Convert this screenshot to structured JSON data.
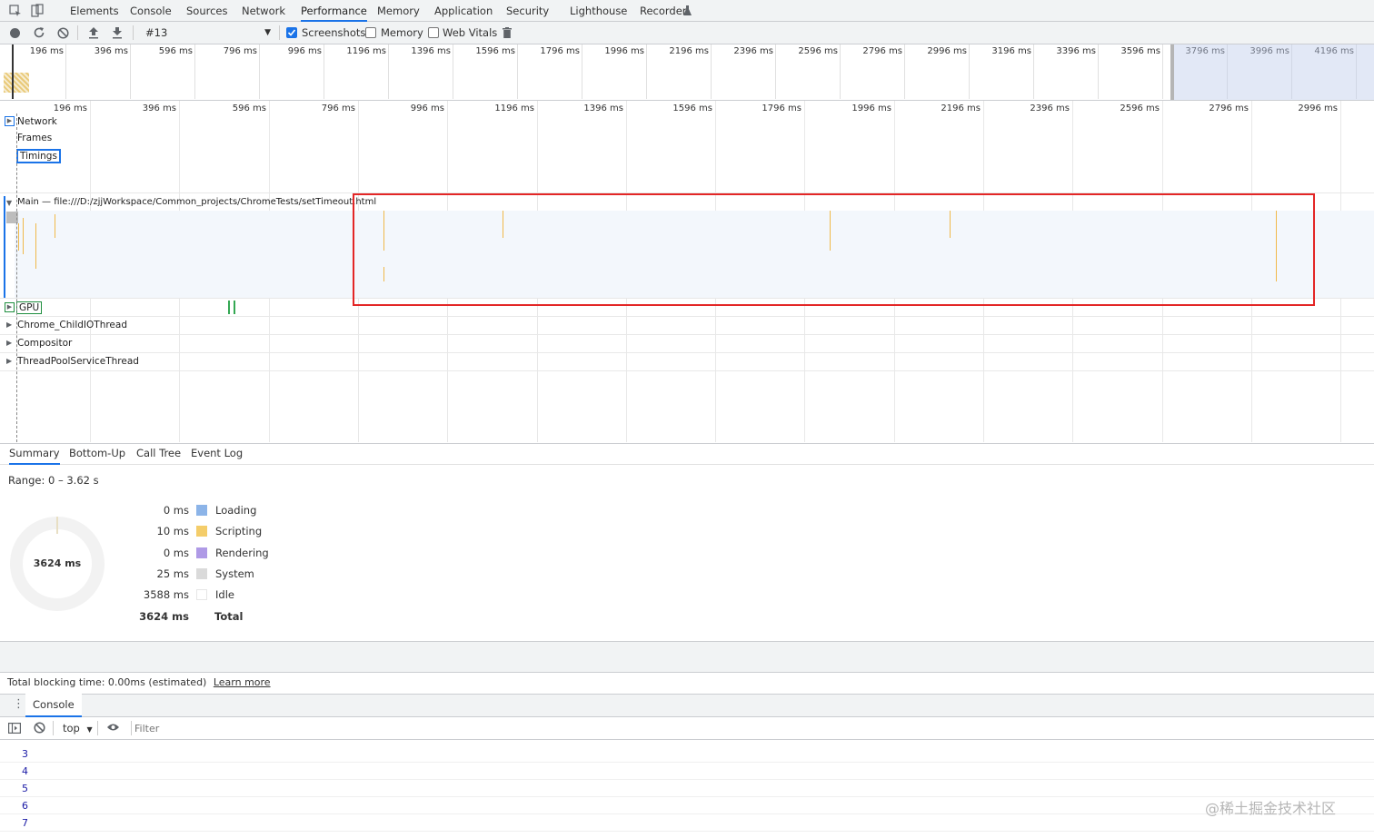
{
  "tabs": [
    "Elements",
    "Console",
    "Sources",
    "Network",
    "Performance",
    "Memory",
    "Application",
    "Security",
    "Lighthouse",
    "Recorder"
  ],
  "active_tab": "Performance",
  "toolbar": {
    "recording_select": "#13",
    "screenshots_label": "Screenshots",
    "screenshots_checked": true,
    "memory_label": "Memory",
    "webvitals_label": "Web Vitals"
  },
  "overview_ticks": [
    "196 ms",
    "396 ms",
    "596 ms",
    "796 ms",
    "996 ms",
    "1196 ms",
    "1396 ms",
    "1596 ms",
    "1796 ms",
    "1996 ms",
    "2196 ms",
    "2396 ms",
    "2596 ms",
    "2796 ms",
    "2996 ms",
    "3196 ms",
    "3396 ms",
    "3596 ms",
    "3796 ms",
    "3996 ms",
    "4196 ms"
  ],
  "ruler_ticks": [
    "196 ms",
    "396 ms",
    "596 ms",
    "796 ms",
    "996 ms",
    "1196 ms",
    "1396 ms",
    "1596 ms",
    "1796 ms",
    "1996 ms",
    "2196 ms",
    "2396 ms",
    "2596 ms",
    "2796 ms",
    "2996 ms"
  ],
  "tracks": {
    "network": "Network",
    "frames": "Frames",
    "timings": "Timings",
    "main": "Main — file:///D:/zjjWorkspace/Common_projects/ChromeTests/setTimeout.html",
    "gpu": "GPU",
    "childio": "Chrome_ChildIOThread",
    "compositor": "Compositor",
    "threadpool": "ThreadPoolServiceThread"
  },
  "detail_tabs": [
    "Summary",
    "Bottom-Up",
    "Call Tree",
    "Event Log"
  ],
  "summary": {
    "range": "Range: 0 – 3.62 s",
    "total_center": "3624 ms",
    "legend": [
      {
        "value": "0 ms",
        "label": "Loading",
        "color": "#8cb4e8"
      },
      {
        "value": "10 ms",
        "label": "Scripting",
        "color": "#f4cd6a"
      },
      {
        "value": "0 ms",
        "label": "Rendering",
        "color": "#af9ae6"
      },
      {
        "value": "25 ms",
        "label": "System",
        "color": "#dadada"
      },
      {
        "value": "3588 ms",
        "label": "Idle",
        "color": "#ffffff"
      }
    ],
    "total_value": "3624 ms",
    "total_label": "Total"
  },
  "footer": {
    "text": "Total blocking time: 0.00ms (estimated)",
    "link": "Learn more"
  },
  "console": {
    "tab": "Console",
    "context": "top",
    "filter_placeholder": "Filter",
    "lines": [
      "3",
      "4",
      "5",
      "6",
      "7"
    ]
  },
  "watermark": "@稀土掘金技术社区"
}
